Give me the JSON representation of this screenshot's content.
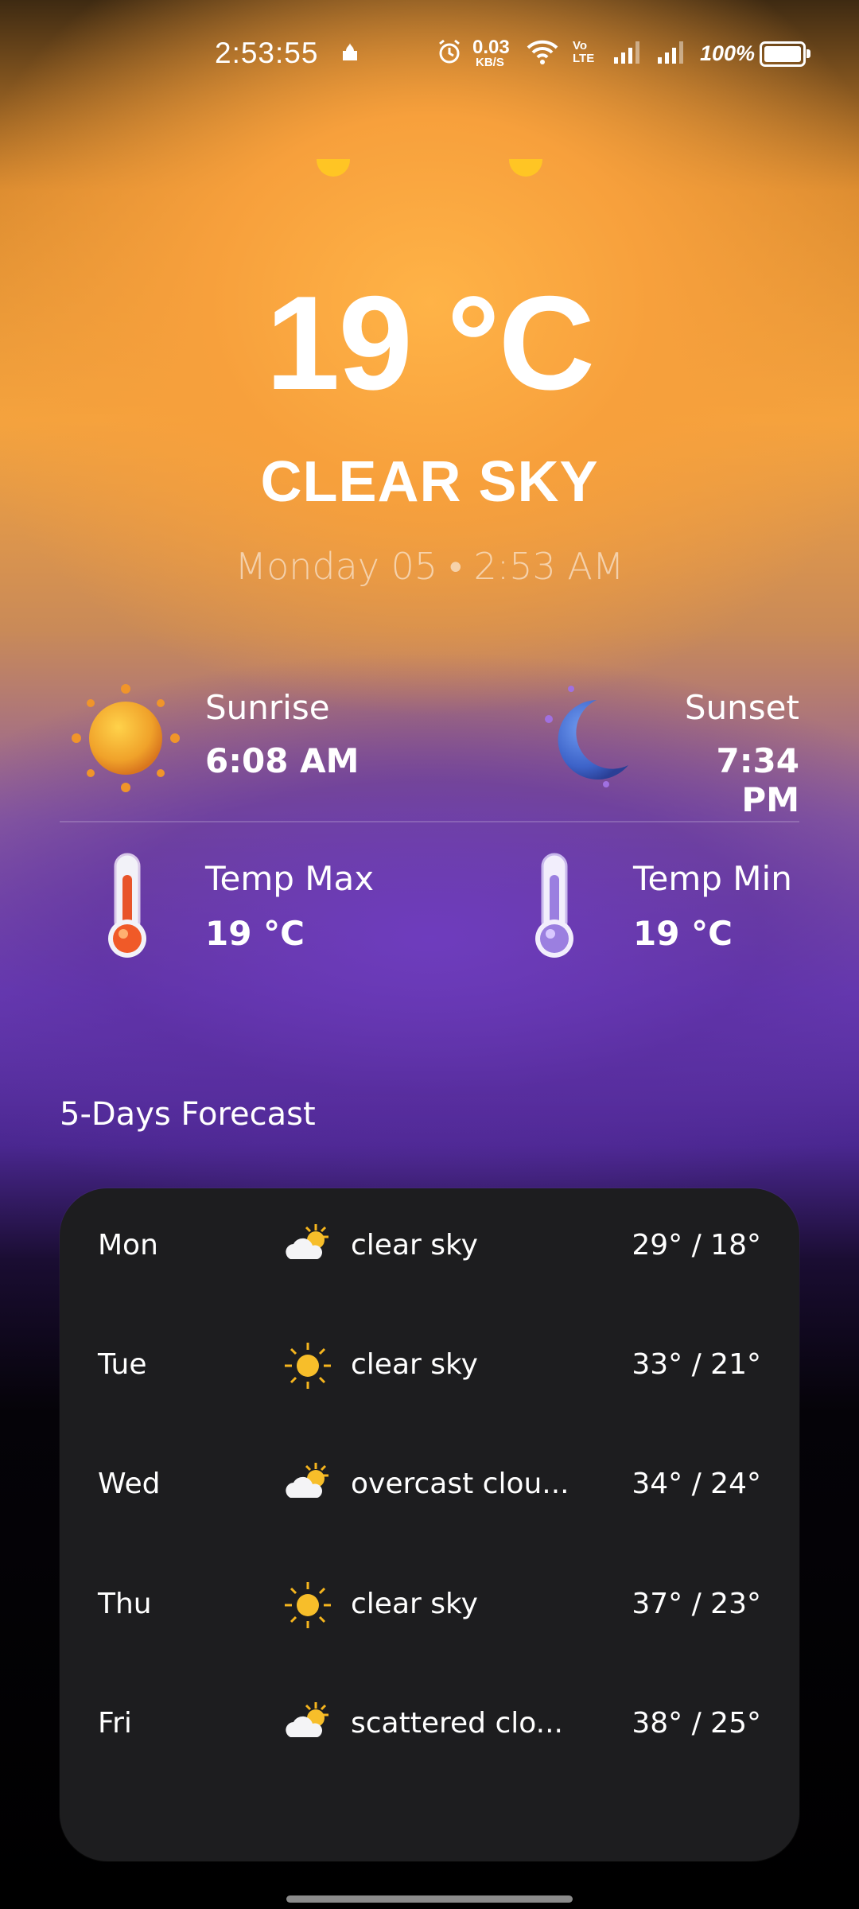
{
  "status_bar": {
    "time": "2:53:55",
    "network_speed": "0.03",
    "network_unit": "KB/S",
    "volte": "Vo LTE",
    "battery": "100%"
  },
  "weather": {
    "temperature": "19 °C",
    "condition": "CLEAR SKY",
    "date_time": "Monday 05 • 2:53 AM"
  },
  "stats": {
    "sunrise": {
      "label": "Sunrise",
      "value": "6:08 AM",
      "icon": "sun-icon"
    },
    "sunset": {
      "label": "Sunset",
      "value": "7:34 PM",
      "icon": "moon-icon"
    },
    "temp_max": {
      "label": "Temp Max",
      "value": "19 °C",
      "icon": "thermometer-hot-icon"
    },
    "temp_min": {
      "label": "Temp Min",
      "value": "19 °C",
      "icon": "thermometer-cold-icon"
    }
  },
  "forecast": {
    "title": "5-Days Forecast",
    "days": [
      {
        "day": "Mon",
        "icon": "partly-cloudy-icon",
        "desc": "clear sky",
        "range": "29° / 18°"
      },
      {
        "day": "Tue",
        "icon": "sun-icon",
        "desc": "clear sky",
        "range": "33° / 21°"
      },
      {
        "day": "Wed",
        "icon": "partly-cloudy-icon",
        "desc": "overcast clou...",
        "range": "34° / 24°"
      },
      {
        "day": "Thu",
        "icon": "sun-icon",
        "desc": "clear sky",
        "range": "37° / 23°"
      },
      {
        "day": "Fri",
        "icon": "partly-cloudy-icon",
        "desc": "scattered clo...",
        "range": "38° / 25°"
      }
    ]
  },
  "colors": {
    "accent_orange": "#f4a33e",
    "accent_purple": "#6a3db6",
    "card_bg": "#1d1d1f"
  }
}
